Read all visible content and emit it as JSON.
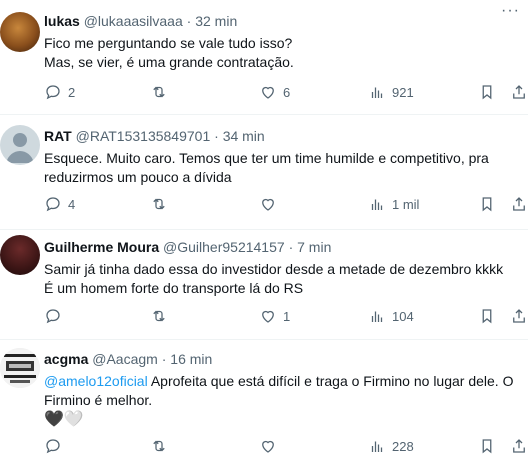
{
  "tweets": [
    {
      "name": "lukas",
      "handle": "@lukaaasilvaaa",
      "dot": "·",
      "time": "32 min",
      "lines": [
        "Fico me perguntando se vale tudo isso?",
        "Mas, se vier, é uma grande contratação."
      ],
      "replies": "2",
      "retweets": "",
      "likes": "6",
      "views": "921"
    },
    {
      "name": "RAT",
      "handle": "@RAT153135849701",
      "dot": "·",
      "time": "34 min",
      "lines": [
        "Esquece. Muito caro. Temos que ter um time humilde e competitivo, pra",
        "reduzirmos um pouco a dívida"
      ],
      "replies": "4",
      "retweets": "",
      "likes": "",
      "views": "1 mil"
    },
    {
      "name": "Guilherme Moura",
      "handle": "@Guilher95214157",
      "dot": "·",
      "time": "7 min",
      "lines": [
        "Samir já tinha dado essa do investidor desde a metade de dezembro kkkk",
        "É um homem forte do transporte lá do RS"
      ],
      "replies": "",
      "retweets": "",
      "likes": "1",
      "views": "104"
    },
    {
      "name": "acgma",
      "handle": "@Aacagm",
      "dot": "·",
      "time": "16 min",
      "mention": "@amelo12oficial",
      "line1_rest": " Aprofeita que está difícil e traga o Firmino no lugar dele. O",
      "line2": "Firmino é melhor.",
      "emojis": "🖤🤍",
      "replies": "",
      "retweets": "",
      "likes": "",
      "views": "228"
    }
  ],
  "icons": [
    "reply-icon",
    "retweet-icon",
    "like-icon",
    "views-icon",
    "bookmark-icon",
    "share-icon",
    "more-icon"
  ],
  "colors": {
    "text": "#0f1419",
    "secondary": "#536471",
    "link": "#1d9bf0",
    "divider": "#eff3f4"
  }
}
